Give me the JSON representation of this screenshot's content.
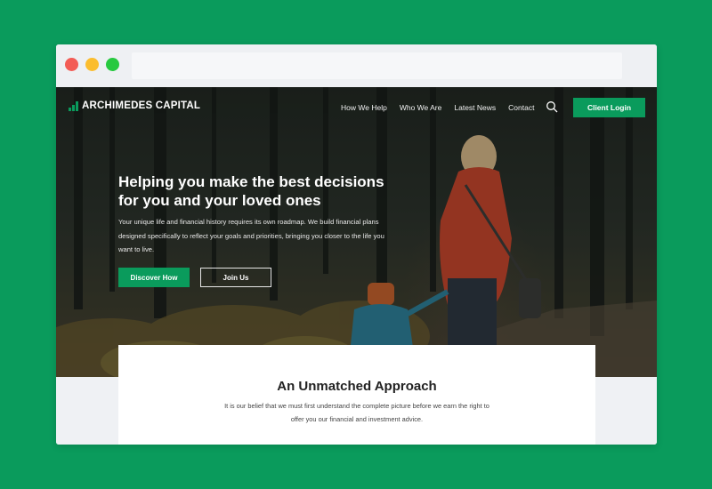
{
  "colors": {
    "background": "#0a9b5c",
    "accent": "#0a9b5c"
  },
  "brand": {
    "name": "ARCHIMEDES CAPITAL",
    "icon": "bar-chart-icon"
  },
  "nav": {
    "items": [
      "How We Help",
      "Who We Are",
      "Latest News",
      "Contact"
    ],
    "search_icon": "search-icon",
    "login_label": "Client Login"
  },
  "hero": {
    "headline": "Helping you make the best decisions for you and your loved ones",
    "subtext": "Your unique life and financial history requires its own roadmap. We build financial plans designed specifically to reflect your goals and priorities, bringing you closer to the life you want to live.",
    "primary_button": "Discover How",
    "secondary_button": "Join Us"
  },
  "approach": {
    "title": "An Unmatched Approach",
    "text": "It is our belief that we must first understand the complete picture before we earn the right to offer you our financial and investment advice."
  }
}
